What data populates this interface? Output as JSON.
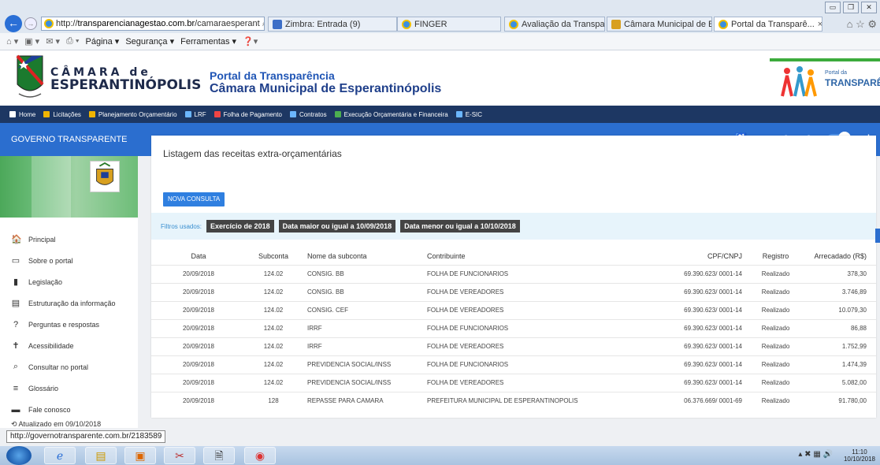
{
  "browser": {
    "address_url_prefix": "http://",
    "address_url_host": "transparencianagestao.com.br",
    "address_url_rest": "/camaraesperant",
    "address_controls": "⌕ ▾ ↻",
    "tabs": [
      {
        "label": "Zimbra: Entrada (9)"
      },
      {
        "label": "FINGER"
      },
      {
        "label": "Avaliação da Transparê..."
      },
      {
        "label": "Câmara Municipal de E..."
      },
      {
        "label": "Portal da Transparê..."
      }
    ],
    "close_tab": "×",
    "command_bar": {
      "page": "Página ▾",
      "security": "Segurança ▾",
      "tools": "Ferramentas ▾"
    },
    "status_url": "http://governotransparente.com.br/2183589"
  },
  "header": {
    "camara_line1": "CÂMARA de",
    "camara_line2": "ESPERANTINÓPOLIS",
    "portal_title": "Portal da Transparência",
    "portal_subtitle": "Câmara Municipal de Esperantinópolis",
    "logo_small": "Portal da",
    "logo_big": "TRANSPARÊNCI"
  },
  "sitenav": [
    {
      "label": "Home",
      "color": "#ffffff"
    },
    {
      "label": "Licitações",
      "color": "#f0b400"
    },
    {
      "label": "Planejamento Orçamentário",
      "color": "#f0b400"
    },
    {
      "label": "LRF",
      "color": "#6bb6ff"
    },
    {
      "label": "Folha de Pagamento",
      "color": "#e44"
    },
    {
      "label": "Contratos",
      "color": "#6bb6ff"
    },
    {
      "label": "Execução Orçamentária e Financeira",
      "color": "#4caf50"
    },
    {
      "label": "E-SIC",
      "color": "#6bb6ff"
    }
  ],
  "gov_bar": {
    "title": "GOVERNO TRANSPARENTE"
  },
  "sidebar": {
    "items": [
      {
        "label": "Principal",
        "icon": "🏠"
      },
      {
        "label": "Sobre o portal",
        "icon": "▭"
      },
      {
        "label": "Legislação",
        "icon": "▮"
      },
      {
        "label": "Estruturação da informação",
        "icon": "▤"
      },
      {
        "label": "Perguntas e respostas",
        "icon": "?"
      },
      {
        "label": "Acessibilidade",
        "icon": "✝"
      },
      {
        "label": "Consultar no portal",
        "icon": "⌕"
      },
      {
        "label": "Glossário",
        "icon": "≡"
      },
      {
        "label": "Fale conosco",
        "icon": "▬"
      }
    ],
    "updated": "Atualizado em 09/10/2018"
  },
  "content": {
    "title": "Listagem das receitas extra-orçamentárias",
    "new_query": "NOVA CONSULTA",
    "filters_label": "Filtros usados:",
    "filters": [
      "Exercício de 2018",
      "Data maior ou igual a 10/09/2018",
      "Data menor ou igual a 10/10/2018"
    ],
    "columns": [
      "Data",
      "Subconta",
      "Nome da subconta",
      "Contribuinte",
      "CPF/CNPJ",
      "Registro",
      "Arrecadado (R$)"
    ],
    "rows": [
      [
        "20/09/2018",
        "124.02",
        "CONSIG. BB",
        "FOLHA DE FUNCIONARIOS",
        "69.390.623/ 0001-14",
        "Realizado",
        "378,30"
      ],
      [
        "20/09/2018",
        "124.02",
        "CONSIG. BB",
        "FOLHA DE VEREADORES",
        "69.390.623/ 0001-14",
        "Realizado",
        "3.746,89"
      ],
      [
        "20/09/2018",
        "124.02",
        "CONSIG. CEF",
        "FOLHA DE VEREADORES",
        "69.390.623/ 0001-14",
        "Realizado",
        "10.079,30"
      ],
      [
        "20/09/2018",
        "124.02",
        "IRRF",
        "FOLHA DE FUNCIONARIOS",
        "69.390.623/ 0001-14",
        "Realizado",
        "86,88"
      ],
      [
        "20/09/2018",
        "124.02",
        "IRRF",
        "FOLHA DE VEREADORES",
        "69.390.623/ 0001-14",
        "Realizado",
        "1.752,99"
      ],
      [
        "20/09/2018",
        "124.02",
        "PREVIDENCIA SOCIAL/INSS",
        "FOLHA DE FUNCIONARIOS",
        "69.390.623/ 0001-14",
        "Realizado",
        "1.474,39"
      ],
      [
        "20/09/2018",
        "124.02",
        "PREVIDENCIA SOCIAL/INSS",
        "FOLHA DE VEREADORES",
        "69.390.623/ 0001-14",
        "Realizado",
        "5.082,00"
      ],
      [
        "20/09/2018",
        "128",
        "REPASSE PARA CAMARA",
        "PREFEITURA MUNICIPAL DE ESPERANTINOPOLIS",
        "06.376.669/ 0001-69",
        "Realizado",
        "91.780,00"
      ]
    ]
  },
  "taskbar": {
    "time": "11:10",
    "date": "10/10/2018"
  }
}
